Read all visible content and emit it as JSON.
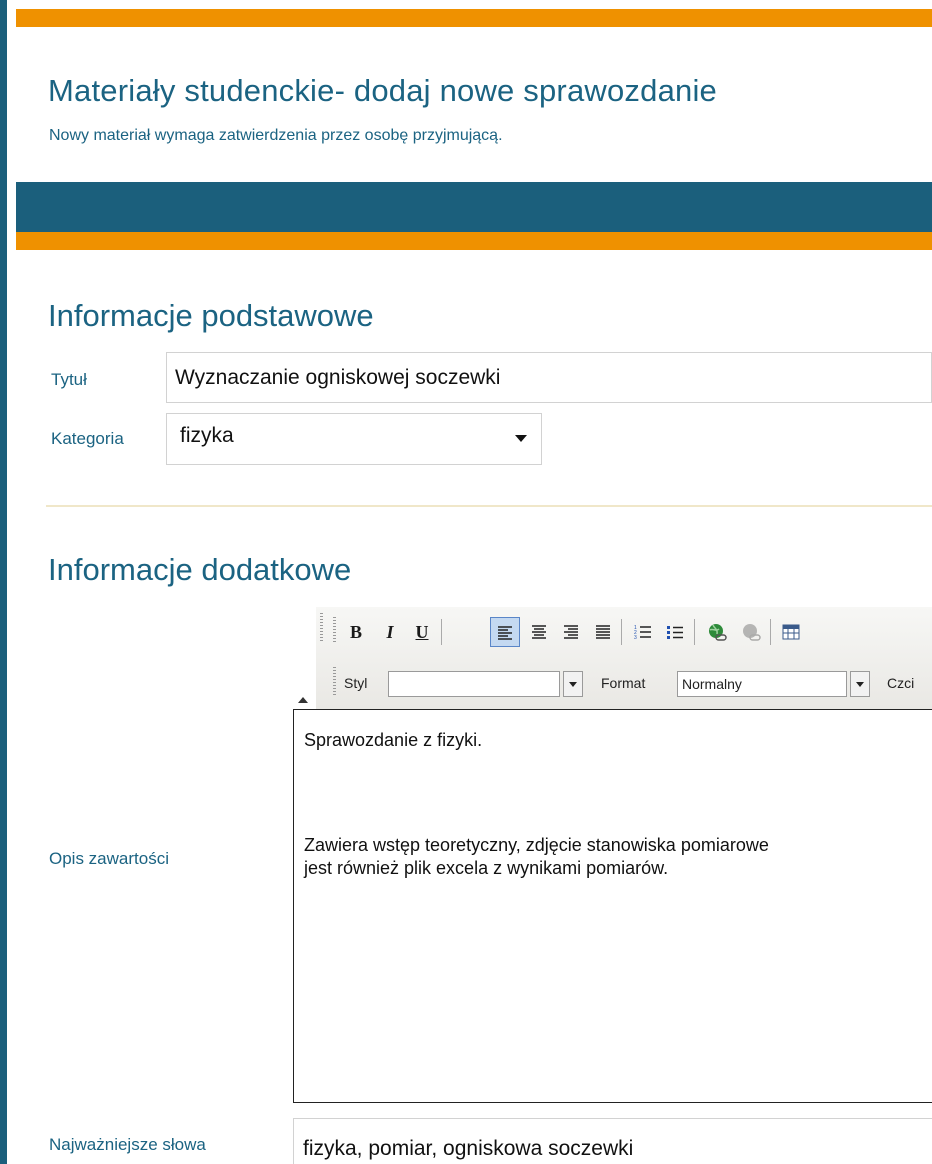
{
  "header": {
    "title": "Materiały studenckie- dodaj nowe sprawozdanie",
    "subtitle": "Nowy materiał wymaga zatwierdzenia przez osobę przyjmującą."
  },
  "basic": {
    "heading": "Informacje podstawowe",
    "title_label": "Tytuł",
    "title_value": "Wyznaczanie ogniskowej soczewki",
    "category_label": "Kategoria",
    "category_value": "fizyka"
  },
  "extra": {
    "heading": "Informacje dodatkowe",
    "description_label": "Opis zawartości",
    "keywords_label": "Najważniejsze słowa",
    "keywords_value": "fizyka, pomiar, ogniskowa soczewki"
  },
  "toolbar": {
    "bold": "B",
    "italic": "I",
    "underline": "U",
    "style_label": "Styl",
    "style_value": "",
    "format_label": "Format",
    "format_value": "Normalny",
    "font_label": "Czci"
  },
  "editor": {
    "lines": [
      "Sprawozdanie z fizyki.",
      "Zawiera wstęp teoretyczny, zdjęcie stanowiska pomiarowe",
      "jest również plik excela z wynikami pomiarów."
    ]
  },
  "colors": {
    "accent_blue": "#1b5f7c",
    "accent_orange": "#ef9100",
    "text_blue": "#1b6382"
  },
  "icons": [
    "align-left-icon",
    "align-center-icon",
    "align-right-icon",
    "align-justify-icon",
    "numbered-list-icon",
    "bulleted-list-icon",
    "link-icon",
    "unlink-icon",
    "table-icon"
  ]
}
